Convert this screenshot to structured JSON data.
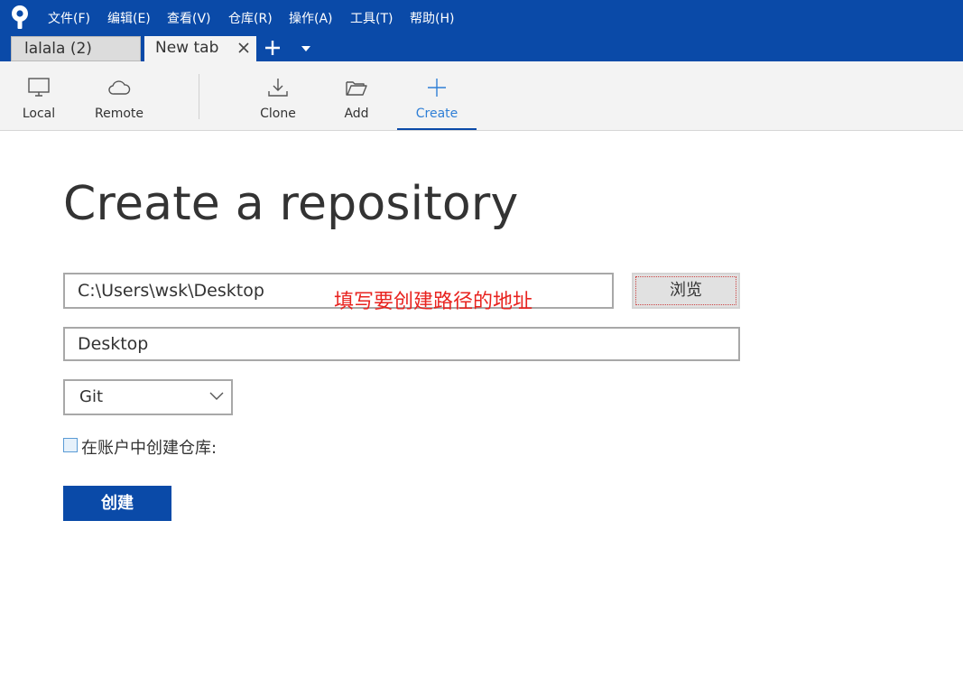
{
  "menu": {
    "items": [
      "文件(F)",
      "编辑(E)",
      "查看(V)",
      "仓库(R)",
      "操作(A)",
      "工具(T)",
      "帮助(H)"
    ]
  },
  "tabs": {
    "items": [
      {
        "label": "lalala (2)",
        "active": false
      },
      {
        "label": "New tab",
        "active": true
      }
    ]
  },
  "toolbar": {
    "local": "Local",
    "remote": "Remote",
    "clone": "Clone",
    "add": "Add",
    "create": "Create",
    "active": "Create"
  },
  "main": {
    "title": "Create a repository",
    "path_value": "C:\\Users\\wsk\\Desktop",
    "annotation": "填写要创建路径的地址",
    "browse_label": "浏览",
    "name_value": "Desktop",
    "vcs_selected": "Git",
    "account_checkbox_label": "在账户中创建仓库:",
    "account_checkbox_checked": false,
    "create_label": "创建"
  },
  "colors": {
    "brand": "#0a4aa8",
    "active_tool_text": "#2f7fd6",
    "annotation": "#e8231f"
  },
  "icons": {
    "app": "sourcetree-logo-icon",
    "local": "monitor-icon",
    "remote": "cloud-icon",
    "clone": "download-icon",
    "add": "folder-open-icon",
    "create": "plus-icon"
  }
}
